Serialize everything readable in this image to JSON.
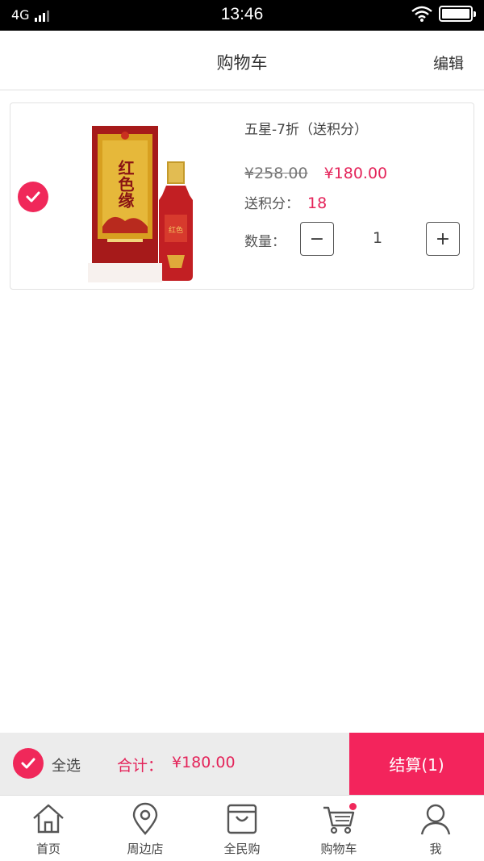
{
  "status_bar": {
    "network": "4G",
    "time": "13:46"
  },
  "header": {
    "title": "购物车",
    "edit_label": "编辑"
  },
  "cart": {
    "items": [
      {
        "name": "五星-7折（送积分）",
        "original_price": "¥258.00",
        "sale_price": "¥180.00",
        "points_label": "送积分：",
        "points_value": "18",
        "quantity_label": "数量：",
        "quantity": "1",
        "minus_symbol": "−",
        "plus_symbol": "+",
        "checked": true,
        "image_brand_text": "红色缘"
      }
    ]
  },
  "checkout_bar": {
    "select_all_label": "全选",
    "total_label": "合计：",
    "total_value": "¥180.00",
    "checkout_label": "结算(1)"
  },
  "tab_bar": {
    "items": [
      {
        "label": "首页",
        "icon": "home-icon"
      },
      {
        "label": "周边店",
        "icon": "location-pin-icon"
      },
      {
        "label": "全民购",
        "icon": "shopping-bag-icon"
      },
      {
        "label": "购物车",
        "icon": "shopping-cart-icon"
      },
      {
        "label": "我",
        "icon": "user-icon"
      }
    ]
  },
  "colors": {
    "accent": "#f0285a",
    "price_red": "#e4245a",
    "checkout_bg": "#f3245c",
    "bar_gray": "#ececec"
  }
}
